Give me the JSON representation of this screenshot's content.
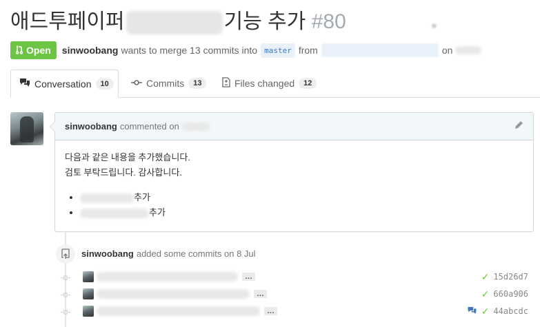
{
  "pr": {
    "title_prefix": "애드투페이퍼",
    "title_suffix": "기능 추가",
    "number": "#80",
    "state": "Open",
    "author": "sinwoobang",
    "merge_text": "wants to merge 13 commits into",
    "base_branch": "master",
    "from_text": "from",
    "on_text": "on"
  },
  "tabs": [
    {
      "label": "Conversation",
      "count": "10",
      "icon": "comment-discussion-icon"
    },
    {
      "label": "Commits",
      "count": "13",
      "icon": "git-commit-icon"
    },
    {
      "label": "Files changed",
      "count": "12",
      "icon": "diff-icon"
    }
  ],
  "comment": {
    "author": "sinwoobang",
    "action": "commented on",
    "line1": "다음과 같은 내용을 추가했습니다.",
    "line2": "검토 부탁드립니다. 감사합니다.",
    "bullets": [
      "추가",
      "추가"
    ]
  },
  "event": {
    "author": "sinwoobang",
    "text": "added some commits on 8 Jul"
  },
  "commits": [
    {
      "sha": "15d26d7",
      "ellipsis": "…",
      "status": "success"
    },
    {
      "sha": "660a906",
      "ellipsis": "…",
      "status": "success"
    },
    {
      "sha": "44abcdc",
      "ellipsis": "…",
      "status": "success",
      "has_comments": true
    }
  ],
  "colors": {
    "open": "#6cc644",
    "link": "#4078c0",
    "check": "#6cc644"
  }
}
